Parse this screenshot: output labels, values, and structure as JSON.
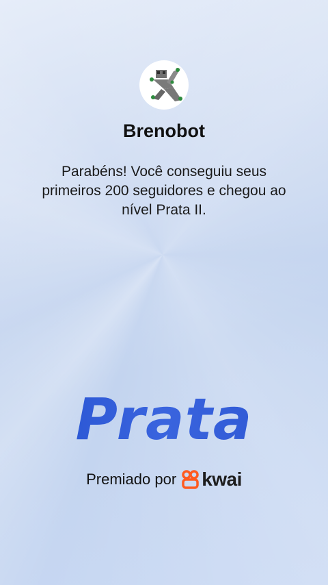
{
  "profile": {
    "name": "Brenobot",
    "avatar_icon": "robot-avatar-icon"
  },
  "message": "Parabéns! Você conseguiu seus primeiros 200 seguidores e chegou ao nível Prata II.",
  "level": {
    "title": "Prata",
    "color": "#2f5ad4"
  },
  "award": {
    "prefix": "Premiado por",
    "brand": "kwai",
    "brand_icon": "kwai-logo-icon",
    "brand_color": "#ff5a1f"
  }
}
